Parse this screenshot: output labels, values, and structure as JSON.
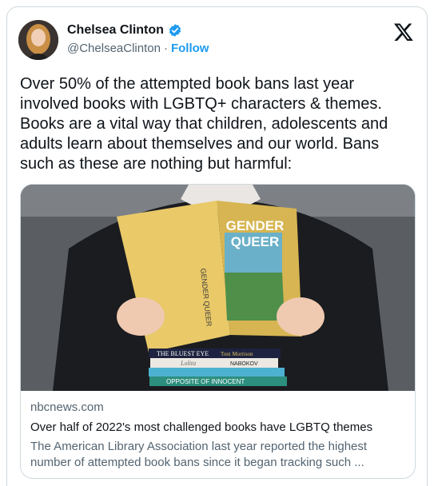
{
  "author": {
    "name": "Chelsea Clinton",
    "handle": "@ChelseaClinton",
    "separator": "·",
    "follow_label": "Follow"
  },
  "tweet": {
    "text": "Over 50% of the attempted book bans last year\ninvolved books with LGBTQ+ characters & themes.\nBooks are a vital way that children, adolescents and\nadults learn about themselves and our world. Bans\nsuch as these are nothing but harmful:"
  },
  "link_card": {
    "domain": "nbcnews.com",
    "title": "Over half of 2022's most challenged books have LGBTQ themes",
    "description": "The American Library Association last year reported the highest\nnumber of attempted book bans since it began tracking such ...",
    "image_text": {
      "book_title_1": "GENDER",
      "book_title_2": "QUEER",
      "spine_text": "GENDER QUEER",
      "stack_1": "THE BLUEST EYE",
      "stack_1_author": "Toni Morrison",
      "stack_2": "Lolita",
      "stack_2_author": "NABOKOV",
      "stack_4": "OPPOSITE OF INNOCENT"
    }
  },
  "colors": {
    "accent": "#1d9bf0",
    "text": "#0f1419",
    "secondary": "#536471",
    "border": "#cfd9de"
  }
}
